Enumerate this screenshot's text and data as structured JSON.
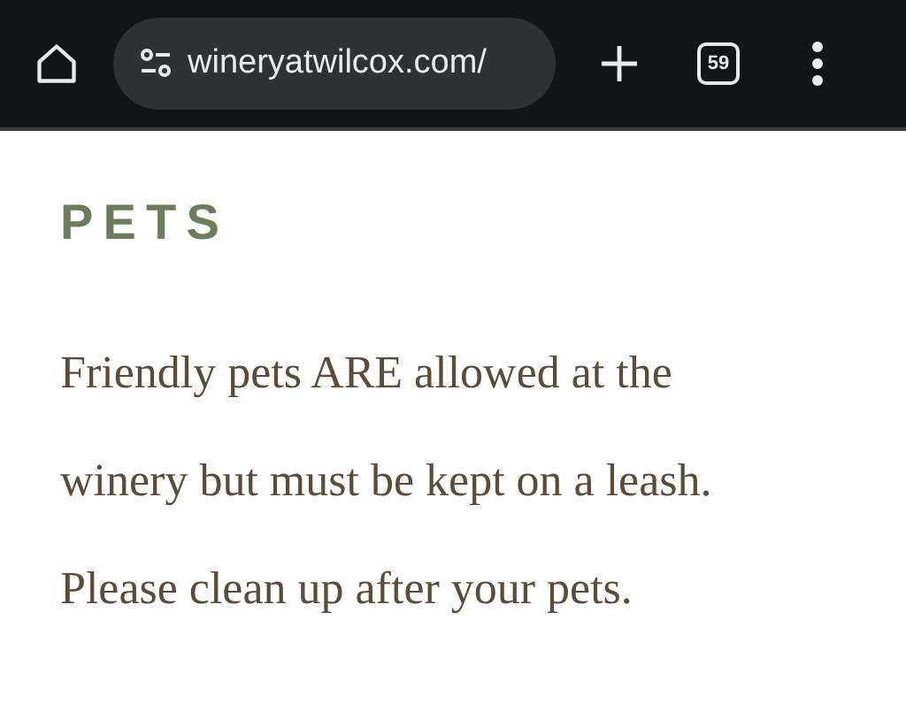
{
  "browser": {
    "url": "wineryatwilcox.com/",
    "tab_count": "59"
  },
  "section": {
    "heading": "PETS",
    "paragraphs": [
      "Friendly pets ARE allowed at the winery but must be kept on a leash.",
      "Please clean up after your pets."
    ]
  }
}
